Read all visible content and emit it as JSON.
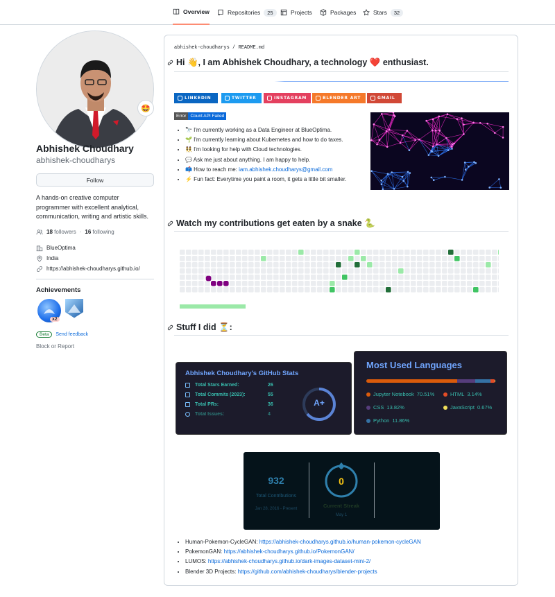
{
  "nav": {
    "tabs": [
      {
        "label": "Overview",
        "count": ""
      },
      {
        "label": "Repositories",
        "count": "25"
      },
      {
        "label": "Projects",
        "count": ""
      },
      {
        "label": "Packages",
        "count": ""
      },
      {
        "label": "Stars",
        "count": "32"
      }
    ]
  },
  "profile": {
    "name": "Abhishek Choudhary",
    "login": "abhishek-choudharys",
    "follow_label": "Follow",
    "bio": "A hands-on creative computer programmer with excellent analytical, communication, writing and artistic skills.",
    "followers_count": "18",
    "followers_label": "followers",
    "dot": "·",
    "following_count": "16",
    "following_label": "following",
    "company": "BlueOptima",
    "location": "India",
    "website": "https://abhishek-choudharys.github.io/",
    "status_emoji": "🤩"
  },
  "achievements": {
    "title": "Achievements",
    "multiplier": "x2",
    "beta": "Beta",
    "feedback": "Send feedback",
    "block": "Block or Report"
  },
  "readme": {
    "path_user": "abhishek-choudharys",
    "path_sep": "/",
    "path_file": "README.md",
    "heading1": "Hi 👋, I am Abhishek Choudhary, a technology ❤️ enthusiast.",
    "badges": [
      {
        "label": "LINKEDIN",
        "color": "#0a66c2"
      },
      {
        "label": "TWITTER",
        "color": "#1d9bf0"
      },
      {
        "label": "INSTAGRAM",
        "color": "#e4405f"
      },
      {
        "label": "BLENDER ART",
        "color": "#f5792a"
      },
      {
        "label": "GMAIL",
        "color": "#d14836"
      }
    ],
    "error_left": "Error",
    "error_right": "Count API Failed",
    "facts": [
      "🔭 I'm currently working as a Data Engineer at BlueOptima.",
      "🌱 I'm currently learning about Kubernetes and how to do taxes.",
      "👯 I'm looking for help with Cloud technologies.",
      "💬 Ask me just about anything. I am happy to help.",
      "📫 How to reach me: ",
      " ⚡ Fun fact: Everytime you paint a room, it gets a little bit smaller."
    ],
    "email": "iam.abhishek.choudharys@gmail.com",
    "heading2": "Watch my contributions get eaten by a snake 🐍",
    "heading3": "Stuff I did ⏳:",
    "stats": {
      "title": "Abhishek Choudhary's GitHub Stats",
      "rows": [
        {
          "label": "Total Stars Earned:",
          "value": "26"
        },
        {
          "label": "Total Commits (2023):",
          "value": "55"
        },
        {
          "label": "Total PRs:",
          "value": "36"
        },
        {
          "label": "Total Issues:",
          "value": "4"
        }
      ],
      "grade": "A+"
    },
    "languages": {
      "title": "Most Used Languages",
      "items": [
        {
          "name": "Jupyter Notebook",
          "pct": "70.51%",
          "color": "#da5b0b"
        },
        {
          "name": "HTML",
          "pct": "3.14%",
          "color": "#e34c26"
        },
        {
          "name": "CSS",
          "pct": "13.82%",
          "color": "#563d7c"
        },
        {
          "name": "JavaScript",
          "pct": "0.67%",
          "color": "#f1e05a"
        },
        {
          "name": "Python",
          "pct": "11.86%",
          "color": "#3572a5"
        }
      ]
    },
    "streak": {
      "total": "932",
      "total_label": "Total Contributions",
      "range": "Jan 28, 2016 - Present",
      "current": "0",
      "current_label": "Current Streak",
      "current_date": "May 1"
    },
    "projects": [
      {
        "label": "Human-Pokemon-CycleGAN: ",
        "url": "https://abhishek-choudharys.github.io/human-pokemon-cycleGAN"
      },
      {
        "label": "PokemonGAN: ",
        "url": "https://abhishek-choudharys.github.io/PokemonGAN/"
      },
      {
        "label": "LUMOS: ",
        "url": "https://abhishek-choudharys.github.io/dark-images-dataset-mini-2/"
      },
      {
        "label": "Blender 3D Projects: ",
        "url": "https://github.com/abhishek-choudharys/blender-projects"
      }
    ]
  }
}
